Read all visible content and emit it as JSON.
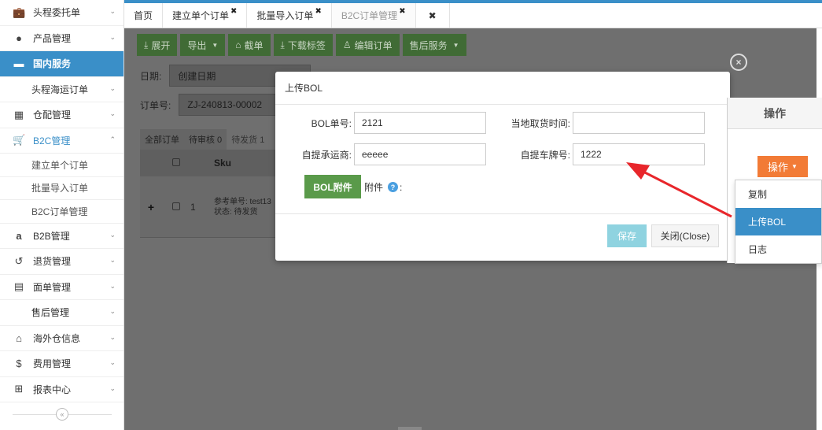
{
  "sidebar": {
    "items": [
      {
        "label": "头程委托单",
        "icon": "briefcase-icon"
      },
      {
        "label": "产品管理",
        "icon": "tag-icon"
      },
      {
        "label": "国内服务",
        "icon": "folder-icon"
      },
      {
        "label": "头程海运订单",
        "icon": ""
      },
      {
        "label": "仓配管理",
        "icon": "grid-icon"
      },
      {
        "label": "B2C管理",
        "icon": "cart-icon"
      },
      {
        "label": "建立单个订单"
      },
      {
        "label": "批量导入订单"
      },
      {
        "label": "B2C订单管理"
      },
      {
        "label": "B2B管理",
        "icon": "amazon-icon"
      },
      {
        "label": "退货管理",
        "icon": "undo-icon"
      },
      {
        "label": "面单管理",
        "icon": "document-icon"
      },
      {
        "label": "售后管理",
        "icon": ""
      },
      {
        "label": "海外仓信息",
        "icon": "home-icon"
      },
      {
        "label": "费用管理",
        "icon": "dollar-icon"
      },
      {
        "label": "报表中心",
        "icon": "table-icon"
      }
    ],
    "collapse_symbol": "«"
  },
  "tabs": [
    {
      "label": "首页"
    },
    {
      "label": "建立单个订单",
      "close": "✖"
    },
    {
      "label": "批量导入订单",
      "close": "✖"
    },
    {
      "label": "B2C订单管理",
      "close": "✖"
    },
    {
      "label": "✖"
    }
  ],
  "toolbar": {
    "expand": "展开",
    "export": "导出",
    "intercept": "截单",
    "download_label": "下载标签",
    "edit_order": "编辑订单",
    "after_sales": "售后服务"
  },
  "filters": {
    "date_label": "日期:",
    "date_value": "创建日期",
    "order_label": "订单号:",
    "order_value": "ZJ-240813-00002"
  },
  "status_tabs": [
    "全部订单",
    "待审核 0",
    "待发货 1"
  ],
  "grid": {
    "header_sku": "Sku",
    "row_index": "1",
    "row_ref": "参考单号: test13",
    "row_status": "状态: 待发货",
    "expand_symbol": "+"
  },
  "modal": {
    "title": "上传BOL",
    "bol_no_label": "BOL单号:",
    "bol_no_value": "2121",
    "pickup_time_label": "当地取货时间:",
    "pickup_time_value": "",
    "carrier_label": "自提承运商:",
    "carrier_value": "eeeee",
    "plate_label": "自提车牌号:",
    "plate_value": "1222",
    "attach_button": "BOL附件",
    "attach_label": "附件",
    "attach_help": "?",
    "attach_colon": ":",
    "save": "保存",
    "close": "关闭(Close)",
    "overlay_close": "×"
  },
  "op_panel": {
    "header": "操作",
    "button": "操作",
    "menu": [
      {
        "label": "复制"
      },
      {
        "label": "上传BOL",
        "highlighted": true
      },
      {
        "label": "日志"
      }
    ]
  },
  "colors": {
    "primary": "#3a8fc8",
    "toolbar_green": "#5a9a4a",
    "op_orange": "#f27b36",
    "arrow_red": "#e8262b",
    "save_disabled": "#8fd3e0"
  }
}
